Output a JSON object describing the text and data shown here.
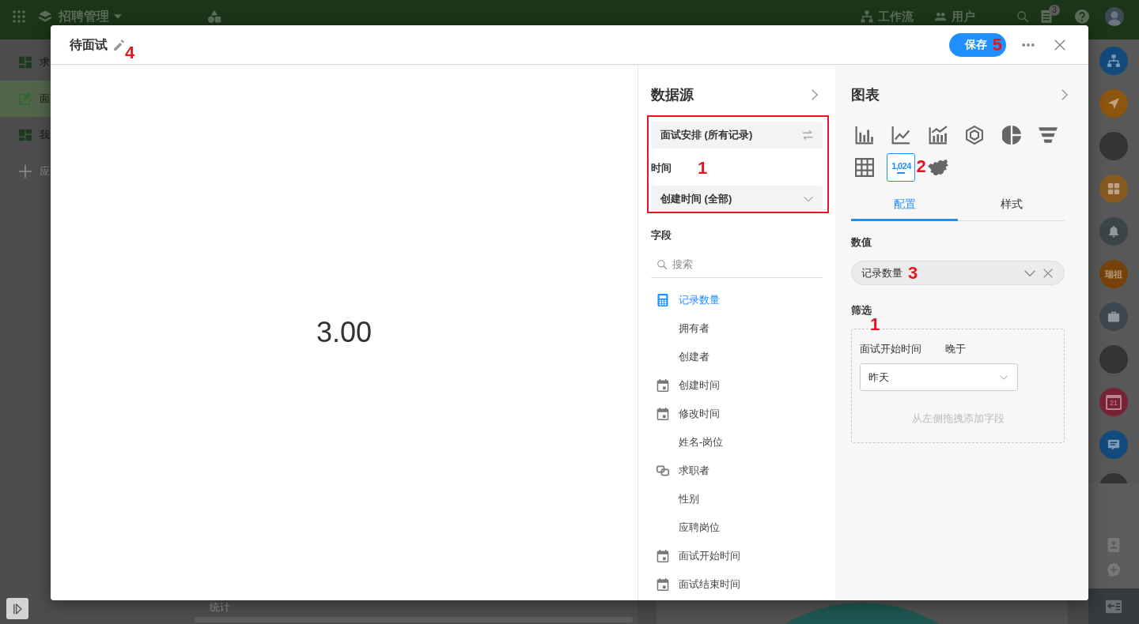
{
  "top_bar": {
    "app_name": "招聘管理",
    "links": [
      {
        "kind": "workflow",
        "label": "工作流"
      },
      {
        "kind": "users",
        "label": "用户"
      }
    ],
    "notification_count": "3"
  },
  "sidebar": {
    "items": [
      {
        "kind": "dashboard",
        "label": "求",
        "selected": false
      },
      {
        "kind": "form",
        "label": "面",
        "selected": true
      },
      {
        "kind": "dashboard",
        "label": "我",
        "selected": false
      }
    ],
    "add_label": "应"
  },
  "main": {
    "footer_label": "统计"
  },
  "right_rail": {
    "apps": [
      {
        "kind": "sitemap",
        "color": "#124a7b"
      },
      {
        "kind": "send",
        "color": "#8c5510"
      },
      {
        "kind": "photo"
      },
      {
        "kind": "apps",
        "color": "#875a22"
      },
      {
        "kind": "bell",
        "color": "#3b4449"
      },
      {
        "kind": "text",
        "label": "瑞祖",
        "color": "#74420a"
      },
      {
        "kind": "briefcase",
        "color": "#3b4852"
      },
      {
        "kind": "photo"
      },
      {
        "kind": "calendar",
        "label": "21",
        "color": "#7a2235"
      },
      {
        "kind": "chat",
        "color": "#124a7b"
      },
      {
        "kind": "photo"
      }
    ]
  },
  "dialog": {
    "title": "待面试",
    "title_callout": "4",
    "save_label": "保存",
    "save_callout": "5"
  },
  "preview": {
    "value": "3.00"
  },
  "data_source": {
    "heading": "数据源",
    "highlighted": true,
    "callout": "1",
    "source": "面试安排 (所有记录)",
    "time_label": "时间",
    "time_value": "创建时间 (全部)",
    "fields_label": "字段",
    "search": {
      "placeholder": "搜索"
    },
    "fields": [
      {
        "label": "记录数量",
        "kind": "count",
        "selected": true
      },
      {
        "label": "拥有者",
        "kind": "plain",
        "selected": false
      },
      {
        "label": "创建者",
        "kind": "plain",
        "selected": false
      },
      {
        "label": "创建时间",
        "kind": "date",
        "selected": false
      },
      {
        "label": "修改时间",
        "kind": "date",
        "selected": false
      },
      {
        "label": "姓名-岗位",
        "kind": "plain",
        "selected": false
      },
      {
        "label": "求职者",
        "kind": "relation",
        "selected": false
      },
      {
        "label": "性别",
        "kind": "plain",
        "selected": false
      },
      {
        "label": "应聘岗位",
        "kind": "plain",
        "selected": false
      },
      {
        "label": "面试开始时间",
        "kind": "date",
        "selected": false
      },
      {
        "label": "面试结束时间",
        "kind": "date",
        "selected": false
      }
    ]
  },
  "chart": {
    "heading": "图表",
    "types": [
      {
        "kind": "bar",
        "selected": false
      },
      {
        "kind": "line",
        "selected": false
      },
      {
        "kind": "combo",
        "selected": false
      },
      {
        "kind": "radar",
        "selected": false
      },
      {
        "kind": "pie",
        "selected": false
      },
      {
        "kind": "funnel",
        "selected": false
      },
      {
        "kind": "table",
        "selected": false
      },
      {
        "kind": "number",
        "label": "1,024",
        "selected": true,
        "callout": "2"
      },
      {
        "kind": "map",
        "selected": false
      }
    ],
    "tabs": [
      {
        "label": "配置",
        "selected": true
      },
      {
        "label": "样式",
        "selected": false
      }
    ],
    "value_label": "数值",
    "value": {
      "label": "记录数量",
      "callout": "3"
    },
    "filter_label": "筛选",
    "filter_callout": "1",
    "filter": {
      "field": "面试开始时间",
      "operator": "晚于",
      "value": "昨天",
      "hint": "从左侧拖拽添加字段"
    }
  }
}
